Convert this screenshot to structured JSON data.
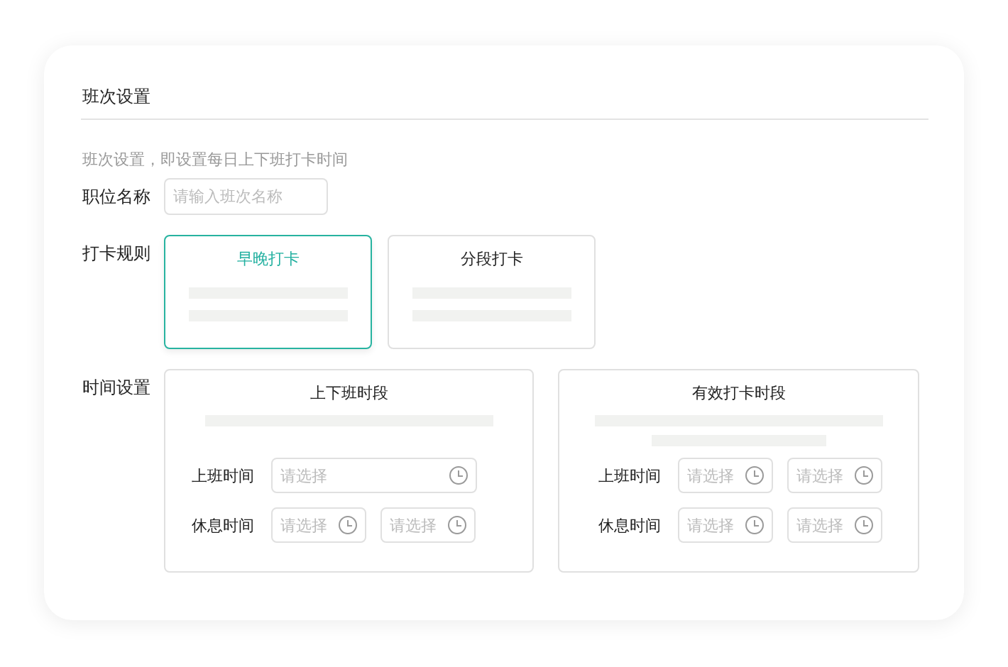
{
  "title": "班次设置",
  "description": "班次设置，即设置每日上下班打卡时间",
  "name_field": {
    "label": "职位名称",
    "placeholder": "请输入班次名称"
  },
  "rule": {
    "label": "打卡规则",
    "options": [
      {
        "label": "早晚打卡",
        "selected": true
      },
      {
        "label": "分段打卡",
        "selected": false
      }
    ]
  },
  "time": {
    "label": "时间设置",
    "panels": [
      {
        "title": "上下班时段",
        "kind": "one-line",
        "rows": [
          {
            "label": "上班时间",
            "fields": [
              {
                "placeholder": "请选择"
              }
            ]
          },
          {
            "label": "休息时间",
            "fields": [
              {
                "placeholder": "请选择"
              },
              {
                "placeholder": "请选择"
              }
            ]
          }
        ]
      },
      {
        "title": "有效打卡时段",
        "kind": "two-line",
        "rows": [
          {
            "label": "上班时间",
            "fields": [
              {
                "placeholder": "请选择"
              },
              {
                "placeholder": "请选择"
              }
            ]
          },
          {
            "label": "休息时间",
            "fields": [
              {
                "placeholder": "请选择"
              },
              {
                "placeholder": "请选择"
              }
            ]
          }
        ]
      }
    ]
  }
}
